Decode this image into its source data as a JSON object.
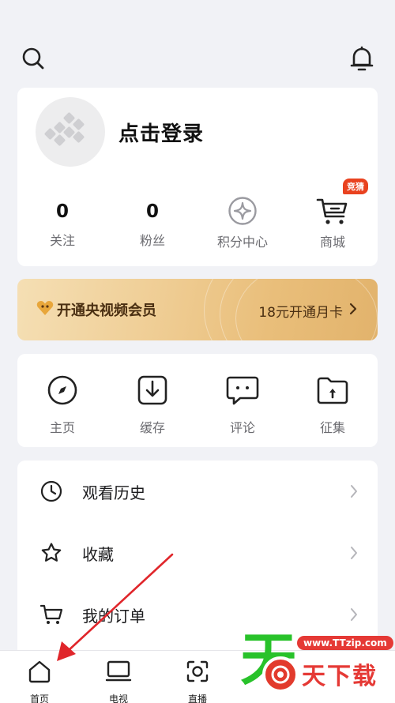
{
  "profile": {
    "login_text": "点击登录",
    "stats": [
      {
        "value": "0",
        "label": "关注"
      },
      {
        "value": "0",
        "label": "粉丝"
      },
      {
        "icon": "points-diamond-icon",
        "label": "积分中心"
      },
      {
        "icon": "shopping-cart-icon",
        "label": "商城",
        "badge": "竞猜"
      }
    ]
  },
  "vip": {
    "title": "开通央视频会员",
    "action": "18元开通月卡",
    "accent": "#4a2f12"
  },
  "tools": [
    {
      "icon": "compass-icon",
      "label": "主页"
    },
    {
      "icon": "download-icon",
      "label": "缓存"
    },
    {
      "icon": "comment-icon",
      "label": "评论"
    },
    {
      "icon": "upload-folder-icon",
      "label": "征集"
    }
  ],
  "menu": [
    {
      "icon": "clock-icon",
      "label": "观看历史"
    },
    {
      "icon": "star-icon",
      "label": "收藏"
    },
    {
      "icon": "cart-icon",
      "label": "我的订单"
    }
  ],
  "tabbar": [
    {
      "icon": "home-icon",
      "label": "首页"
    },
    {
      "icon": "tv-icon",
      "label": "电视"
    },
    {
      "icon": "live-icon",
      "label": "直播"
    }
  ],
  "watermark": {
    "big_char": "天",
    "url": "www.TTzip.com",
    "text": "天下载"
  },
  "colors": {
    "background": "#f1f2f6",
    "annotation_arrow": "#e0262b",
    "badge": "#e9421f"
  }
}
